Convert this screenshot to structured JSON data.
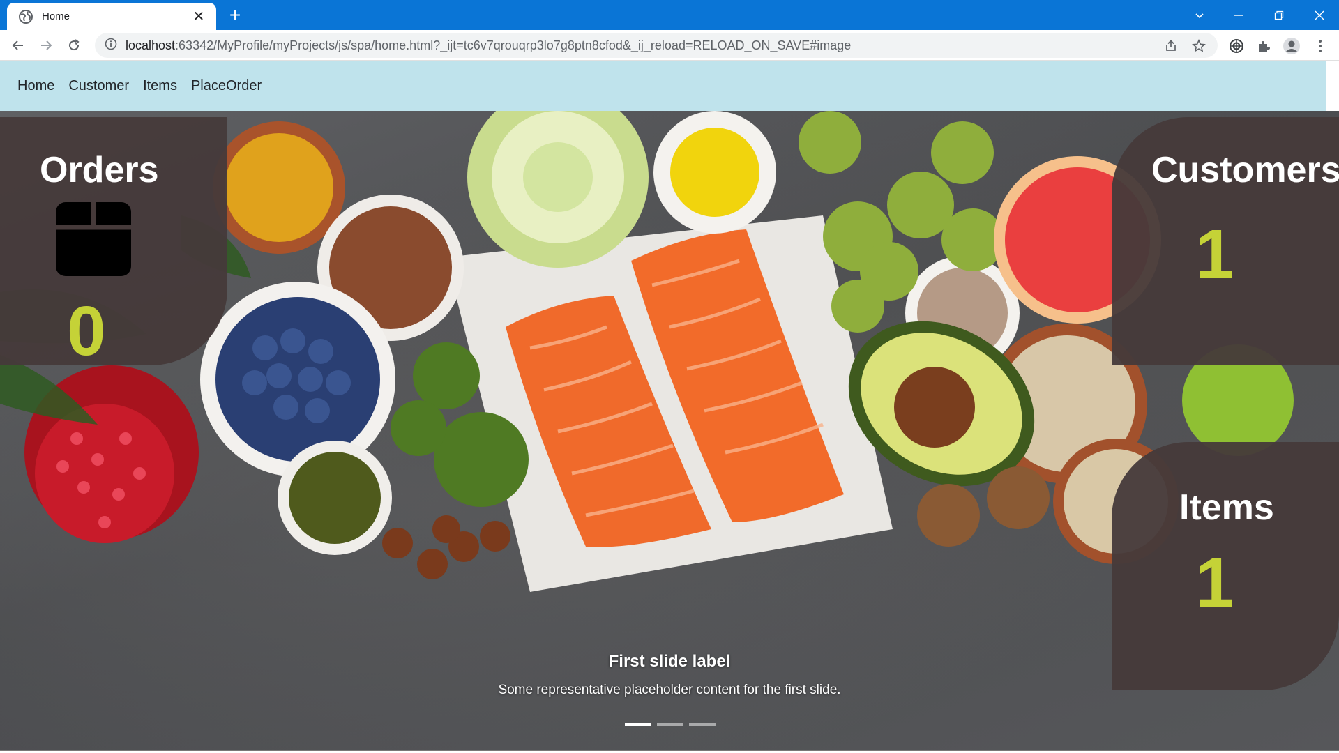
{
  "browser": {
    "tab_title": "Home",
    "url_host": "localhost",
    "url_rest": ":63342/MyProfile/myProjects/js/spa/home.html?_ijt=tc6v7qrouqrp3lo7g8ptn8cfod&_ij_reload=RELOAD_ON_SAVE#image",
    "chrome_color": "#0a75d6"
  },
  "navbar": {
    "items": [
      "Home",
      "Customer",
      "Items",
      "PlaceOrder"
    ],
    "background": "#bfe3ec"
  },
  "cards": {
    "orders": {
      "title": "Orders",
      "count": "0",
      "icon": "box-icon"
    },
    "customers": {
      "title": "Customers",
      "count": "1"
    },
    "items": {
      "title": "Items",
      "count": "1"
    },
    "accent_color": "#c5d237"
  },
  "carousel": {
    "caption_title": "First slide label",
    "caption_text": "Some representative placeholder content for the first slide.",
    "slides": 3,
    "active_slide": 1
  }
}
